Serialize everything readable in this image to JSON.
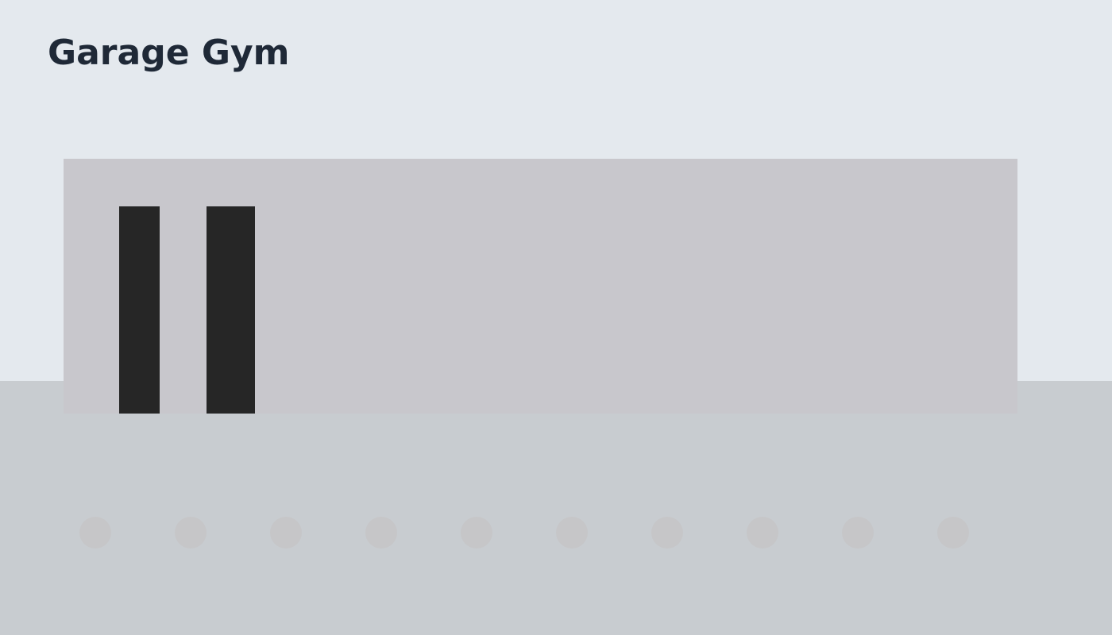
{
  "page": {
    "title": "Garage Gym"
  },
  "colors": {
    "wall": "#e4e9ee",
    "floor": "#c8ccd0",
    "rack_panel": "#c8c7cc",
    "upright": "#262626",
    "floor_dot": "#c6c6c8",
    "title": "#1f2937"
  },
  "floor_dots": {
    "count": 10
  }
}
